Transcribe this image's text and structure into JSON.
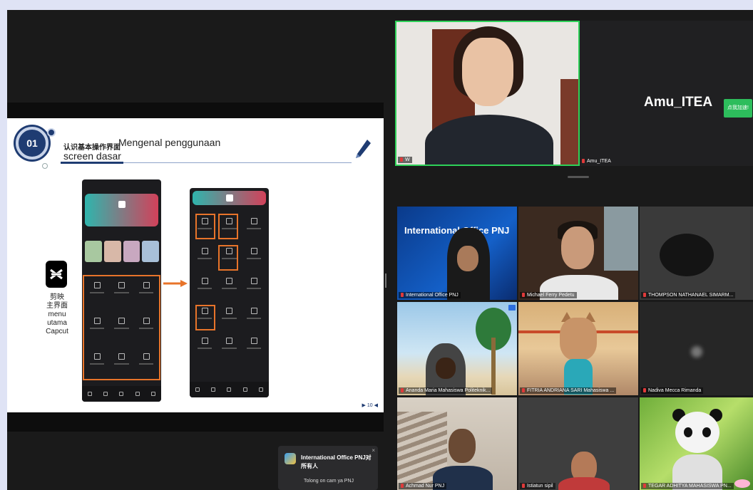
{
  "slide": {
    "badge": "01",
    "title_zh": "认识基本操作界面",
    "title_id_1": "Mengenal penggunaan",
    "title_id_2": "screen dasar",
    "label_lines": [
      "剪映",
      "主界面",
      "menu",
      "utama",
      "Capcut"
    ],
    "footer": "▶ 10 ◀"
  },
  "speaker": {
    "name": "W",
    "host_display_name": "Amu_ITEA",
    "host_label": "Amu_ITEA",
    "host_button": "点我加速!"
  },
  "gallery": [
    {
      "name": "International Office PNJ",
      "banner": "International Office PNJ"
    },
    {
      "name": "Michael Ferry Pedetu"
    },
    {
      "name": "THOMPSON NATHANAEL SIMARM..."
    },
    {
      "name": "Ananda Maria Mahasiswa Politeknik..."
    },
    {
      "name": "FITRIA ANDRIANA SARI Mahasiswa ..."
    },
    {
      "name": "Nadiva Mecca Rimanda"
    },
    {
      "name": "Achmad Nur PNJ"
    },
    {
      "name": "Istiatun sipil"
    },
    {
      "name": "TEGAR ADHITYA MAHASISWA PN..."
    }
  ],
  "chat": {
    "sender": "International Office PNJ对所有人",
    "message": "Tolong on cam ya PNJ",
    "close": "×"
  },
  "colors": {
    "active_speaker_border": "#2ed158",
    "accent_orange": "#e8742a",
    "slide_navy": "#1f3c72"
  }
}
